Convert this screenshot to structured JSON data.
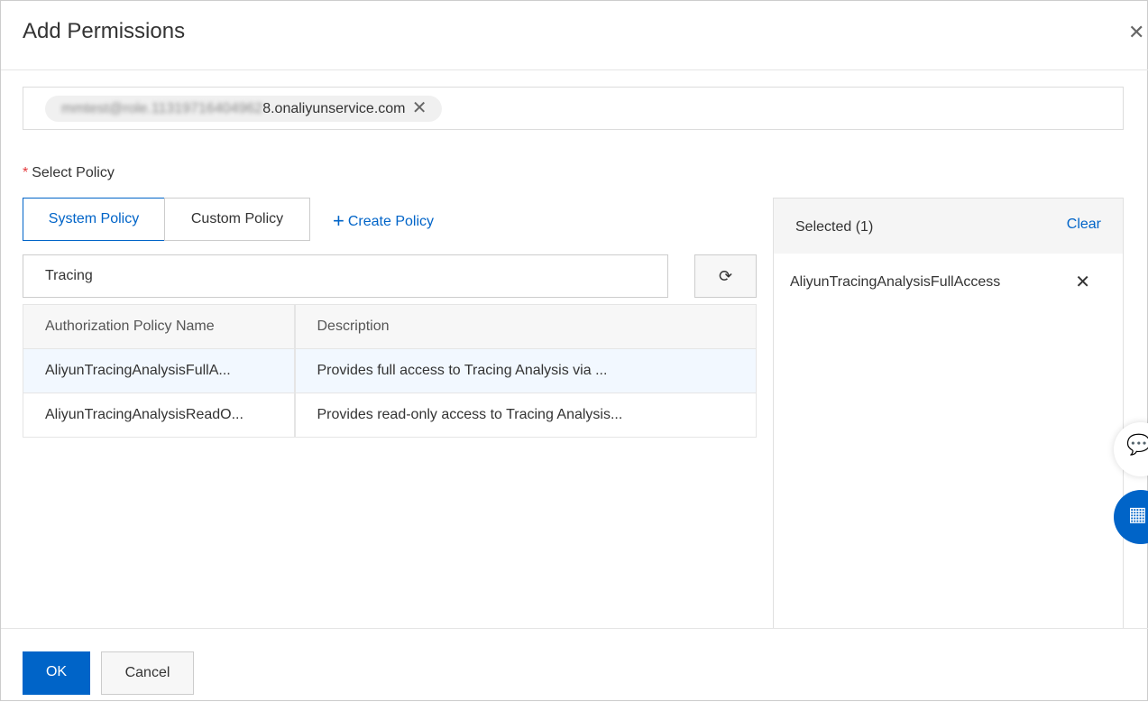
{
  "dialog": {
    "title": "Add Permissions",
    "close_icon": "close-icon"
  },
  "principal": {
    "blurred_prefix": "mmtest@role.11319716404962",
    "visible_suffix": "8.onaliyunservice.com"
  },
  "policy": {
    "label": "Select Policy",
    "tabs": [
      {
        "label": "System Policy",
        "active": true
      },
      {
        "label": "Custom Policy",
        "active": false
      }
    ],
    "create_label": "Create Policy",
    "search_value": "Tracing"
  },
  "table": {
    "headers": [
      "Authorization Policy Name",
      "Description"
    ],
    "rows": [
      {
        "name": "AliyunTracingAnalysisFullA...",
        "description": "Provides full access to Tracing Analysis via ...",
        "selected": true
      },
      {
        "name": "AliyunTracingAnalysisReadO...",
        "description": "Provides read-only access to Tracing Analysis...",
        "selected": false
      }
    ]
  },
  "selected": {
    "title": "Selected (1)",
    "clear_label": "Clear",
    "items": [
      "AliyunTracingAnalysisFullAccess"
    ]
  },
  "footer": {
    "ok_label": "OK",
    "cancel_label": "Cancel"
  },
  "colors": {
    "accent": "#0064c8",
    "required": "#e4393c"
  }
}
